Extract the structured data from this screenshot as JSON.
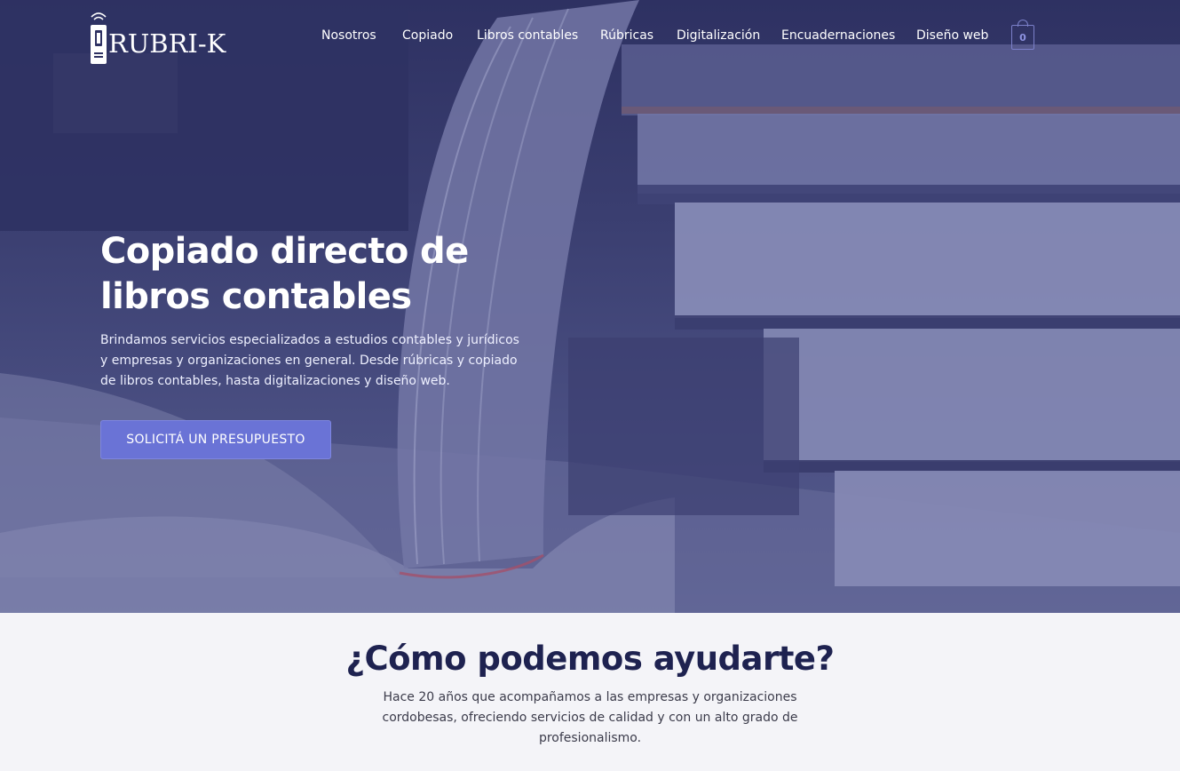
{
  "brand": {
    "logo_text": "RUBRI-K",
    "logo_icon": "usb-device-icon"
  },
  "nav": {
    "items": [
      "Nosotros",
      "Copiado",
      "Libros contables",
      "Rúbricas",
      "Digitalización",
      "Encuadernaciones",
      "Diseño web"
    ],
    "cart_count": "0",
    "cart_icon": "shopping-bag-icon"
  },
  "hero": {
    "title_line1": "Copiado directo de",
    "title_line2": "libros contables",
    "description": "Brindamos servicios especializados a estudios contables y jurídicos y empresas y organizaciones en general. Desde rúbricas y copiado de libros contables, hasta digitalizaciones y diseño web.",
    "cta_label": "SOLICITÁ UN PRESUPUESTO"
  },
  "help_section": {
    "title": "¿Cómo podemos ayudarte?",
    "text": "Hace 20 años que acompañamos a las empresas y organizaciones cordobesas, ofreciendo servicios de calidad y con un alto grado de profesionalismo."
  },
  "colors": {
    "overlay": "#3a3e70",
    "accent": "#6a73d6",
    "heading_dark": "#1e2250",
    "section_bg": "#f4f4f8"
  }
}
